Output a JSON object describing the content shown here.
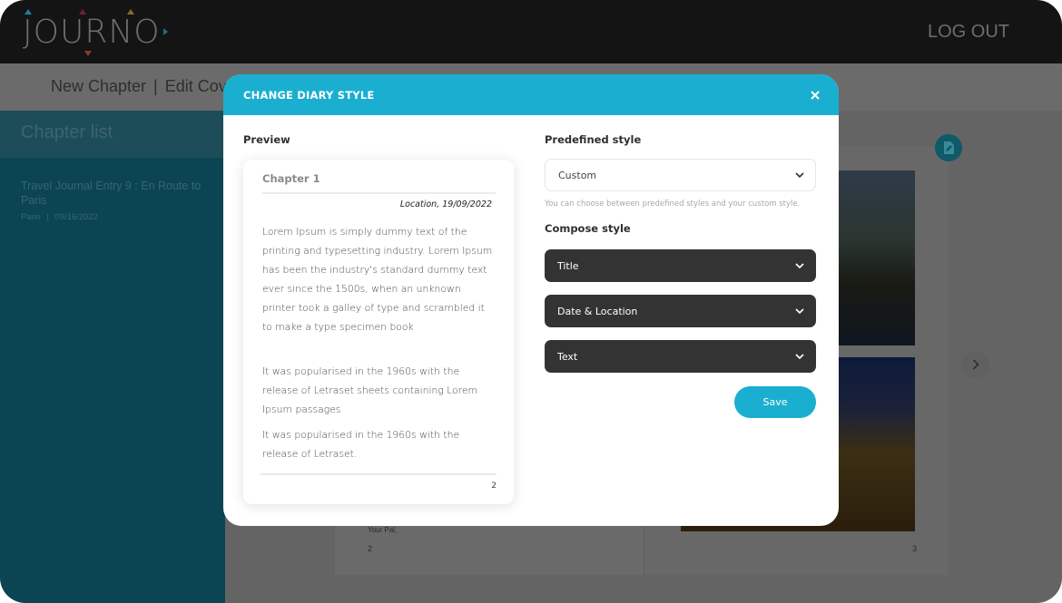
{
  "app": {
    "logo_letters": [
      "J",
      "O",
      "U",
      "R",
      "N",
      "O"
    ],
    "logout_label": "LOG OUT",
    "brand_colors": {
      "primary": "#1aafd0",
      "sidebar": "#0b4553",
      "dark_button": "#333333",
      "topbar": "#141414"
    }
  },
  "subnav": {
    "links": [
      "New Chapter",
      "Edit Cover"
    ],
    "separator": "|"
  },
  "sidebar": {
    "title": "Chapter list",
    "entries": [
      {
        "title": "Travel Journal Entry 9 : En Route to Paris",
        "location": "Paris",
        "date": "09/16/2022",
        "separator": "|"
      }
    ]
  },
  "book": {
    "signature": "Your Pal,",
    "left_page_number": "2",
    "right_page_number": "3",
    "edit_icon": "edit-document-icon",
    "next_icon": "chevron-right-icon"
  },
  "modal": {
    "title": "CHANGE DIARY STYLE",
    "close_icon": "close-icon",
    "preview": {
      "label": "Preview",
      "chapter_title": "Chapter 1",
      "location_date": "Location, 19/09/2022",
      "paragraphs": [
        "Lorem Ipsum is simply dummy text of the printing and typesetting industry. Lorem Ipsum has been the industry's standard dummy text ever since the 1500s, when an unknown printer took a galley of type and scrambled it to make a type specimen book",
        "It was popularised in the 1960s with the release of Letraset sheets containing Lorem Ipsum passages",
        "It was popularised in the 1960s with the release of Letraset."
      ],
      "page_number": "2"
    },
    "predefined": {
      "label": "Predefined style",
      "selected": "Custom",
      "hint": "You can choose between predefined styles and your custom style."
    },
    "compose": {
      "label": "Compose style",
      "sections": [
        "Title",
        "Date & Location",
        "Text"
      ]
    },
    "save_label": "Save"
  }
}
